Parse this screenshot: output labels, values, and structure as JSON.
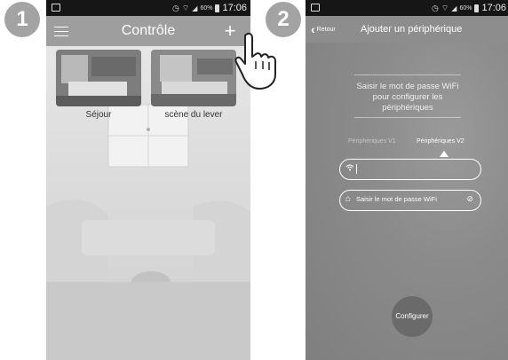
{
  "steps": [
    "1",
    "2"
  ],
  "screen1": {
    "status": {
      "battery": "60%",
      "time": "17:06"
    },
    "title": "Contrôle",
    "scenes": [
      {
        "label": "Séjour"
      },
      {
        "label": "scène du lever"
      }
    ]
  },
  "screen2": {
    "status": {
      "battery": "60%",
      "time": "17:06"
    },
    "back_label": "Retour",
    "title": "Ajouter un périphérique",
    "instruction": "Saisir le mot de passe WiFi pour configurer les périphériques",
    "tabs": [
      {
        "label": "Périphériques V1",
        "active": false
      },
      {
        "label": "Périphériques V2",
        "active": true
      }
    ],
    "ssid_value": "",
    "password_placeholder": "Saisir le mot de passe WiFi",
    "configure_label": "Configurer"
  },
  "colors": {
    "badge": "#a3a3a3",
    "titlebar": "#9e9e9e",
    "statusbar": "#161616"
  }
}
